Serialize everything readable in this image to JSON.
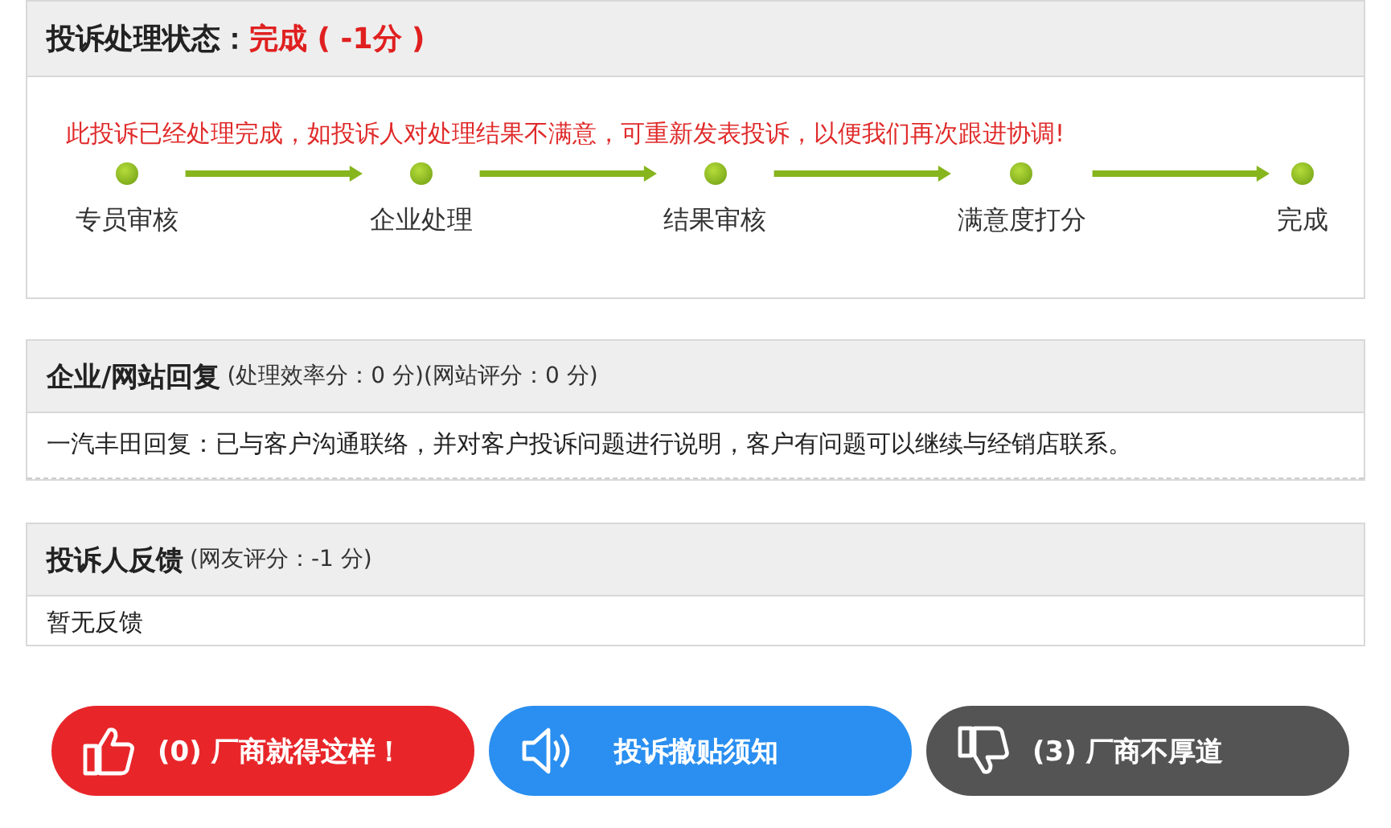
{
  "status_panel": {
    "title": "投诉处理状态：",
    "status": "完成 ( -1分 )",
    "notice": "此投诉已经处理完成，如投诉人对处理结果不满意，可重新发表投诉，以便我们再次跟进协调!",
    "steps": [
      {
        "label": "专员审核",
        "done": true
      },
      {
        "label": "企业处理",
        "done": true
      },
      {
        "label": "结果审核",
        "done": true
      },
      {
        "label": "满意度打分",
        "done": true
      },
      {
        "label": "完成",
        "done": true
      }
    ]
  },
  "reply_panel": {
    "title": "企业/网站回复",
    "scores": "(处理效率分：0 分)(网站评分：0 分)",
    "body": "一汽丰田回复：已与客户沟通联络，并对客户投诉问题进行说明，客户有问题可以继续与经销店联系。"
  },
  "feedback_panel": {
    "title": "投诉人反馈",
    "scores": "(网友评分：-1 分)",
    "body": "暂无反馈"
  },
  "buttons": [
    {
      "kind": "like",
      "label": "(0) 厂商就得这样！",
      "color": "#e8262a"
    },
    {
      "kind": "notice",
      "label": "投诉撤贴须知",
      "color": "#2a8ff0"
    },
    {
      "kind": "dislike",
      "label": "(3) 厂商不厚道",
      "color": "#545454"
    }
  ]
}
